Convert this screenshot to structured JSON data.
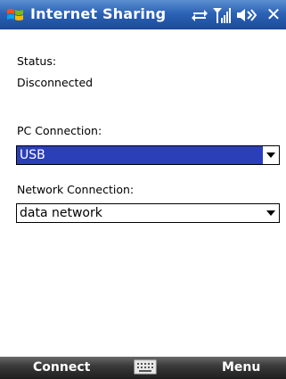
{
  "titlebar": {
    "title": "Internet Sharing",
    "icons": [
      "start-logo",
      "sync-arrows-icon",
      "signal-strength-icon",
      "volume-icon"
    ],
    "close_label": "✕"
  },
  "status": {
    "label": "Status:",
    "value": "Disconnected"
  },
  "pc_connection": {
    "label": "PC Connection:",
    "value": "USB",
    "selected": true,
    "highlight_color": "#2b3fb8"
  },
  "network_connection": {
    "label": "Network Connection:",
    "value": "data network"
  },
  "menubar": {
    "left_softkey": "Connect",
    "right_softkey": "Menu",
    "center_icon": "keyboard-icon"
  },
  "colors": {
    "titlebar": "#2c63b6",
    "menubar": "#2e2e2e"
  }
}
